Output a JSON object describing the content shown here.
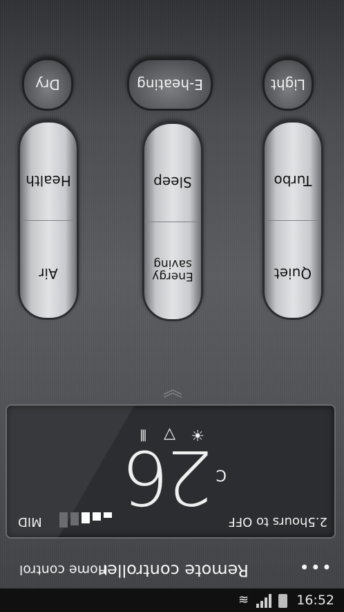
{
  "status_bar": {
    "time": "16:52"
  },
  "action_bar": {
    "title": "Remote controller",
    "home_label": "Home control",
    "overflow_glyph": "•••"
  },
  "display": {
    "timer_text": "2.5hours to OFF",
    "temperature": "26",
    "unit": "C",
    "fan_speed_label": "MID",
    "fan_level_fraction": 0.6,
    "mode_icons": [
      "swing-icon",
      "shield-icon",
      "sun-icon"
    ]
  },
  "buttons": {
    "pill_left": {
      "top": "Quiet",
      "bottom": "Turbo"
    },
    "pill_middle": {
      "top": "Energy saving",
      "bottom": "Sleep"
    },
    "pill_right": {
      "top": "Air",
      "bottom": "Health"
    },
    "round_left": "Light",
    "round_middle": "E-heating",
    "round_right": "Dry"
  },
  "colors": {
    "panel_bg": "#2b2d30",
    "text_light": "#f0f0f0",
    "pill_face": "#e2e3e5"
  }
}
